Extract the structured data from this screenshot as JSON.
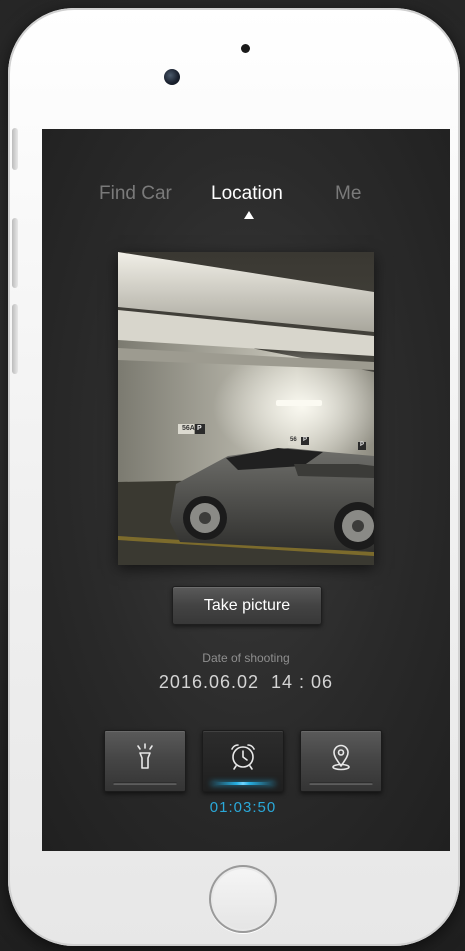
{
  "tabs": {
    "find_car": "Find Car",
    "location": "Location",
    "me": "Me",
    "active": "Location"
  },
  "photo": {
    "signs": [
      "56A",
      "P",
      "56",
      "P",
      "P"
    ]
  },
  "actions": {
    "take_picture": "Take picture"
  },
  "shooting": {
    "label": "Date of shooting",
    "value": "2016.06.02  14 : 06"
  },
  "tools": {
    "items": [
      {
        "icon": "flashlight-icon",
        "active": false
      },
      {
        "icon": "alarm-clock-icon",
        "active": true
      },
      {
        "icon": "map-pin-icon",
        "active": false
      }
    ],
    "timer": "01:03:50"
  },
  "colors": {
    "accent": "#2aa8d8",
    "screen_bg": "#2a2a2a",
    "phone_body": "#f1f1f1"
  }
}
